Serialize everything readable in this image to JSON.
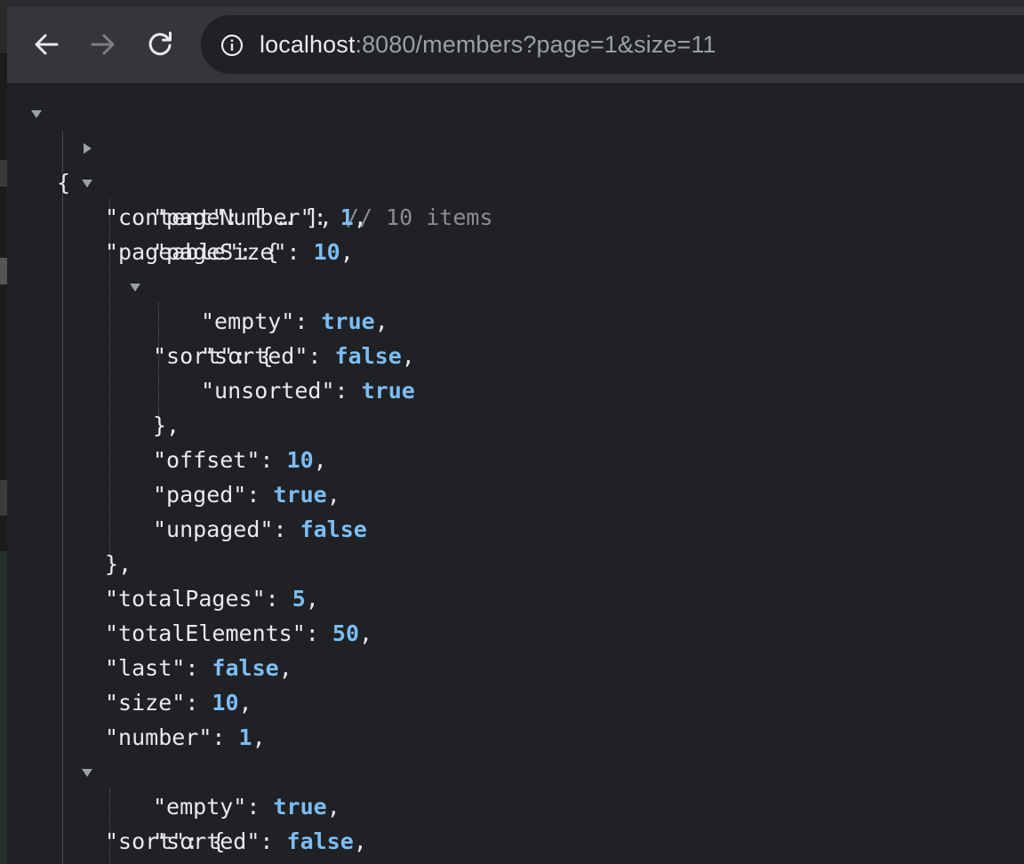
{
  "browser": {
    "url_host": "localhost",
    "url_rest": ":8080/members?page=1&size=11"
  },
  "json": {
    "open_brace": "{",
    "content_key": "\"content\"",
    "content_value": "[ … ],",
    "content_comment": "// 10 items",
    "pageable_key": "\"pageable\"",
    "pageNumber_key": "\"pageNumber\"",
    "pageNumber_value": "1",
    "pageSize_key": "\"pageSize\"",
    "pageSize_value": "10",
    "sort_key": "\"sort\"",
    "empty_key": "\"empty\"",
    "empty_value": "true",
    "sorted_key": "\"sorted\"",
    "sorted_value": "false",
    "unsorted_key": "\"unsorted\"",
    "unsorted_value": "true",
    "offset_key": "\"offset\"",
    "offset_value": "10",
    "paged_key": "\"paged\"",
    "paged_value": "true",
    "unpaged_key": "\"unpaged\"",
    "unpaged_value": "false",
    "totalPages_key": "\"totalPages\"",
    "totalPages_value": "5",
    "totalElements_key": "\"totalElements\"",
    "totalElements_value": "50",
    "last_key": "\"last\"",
    "last_value": "false",
    "size_key": "\"size\"",
    "size_value": "10",
    "number_key": "\"number\"",
    "number_value": "1",
    "sort2_key": "\"sort\"",
    "empty2_key": "\"empty\"",
    "empty2_value": "true",
    "sorted2_key": "\"sorted\"",
    "sorted2_value": "false"
  }
}
